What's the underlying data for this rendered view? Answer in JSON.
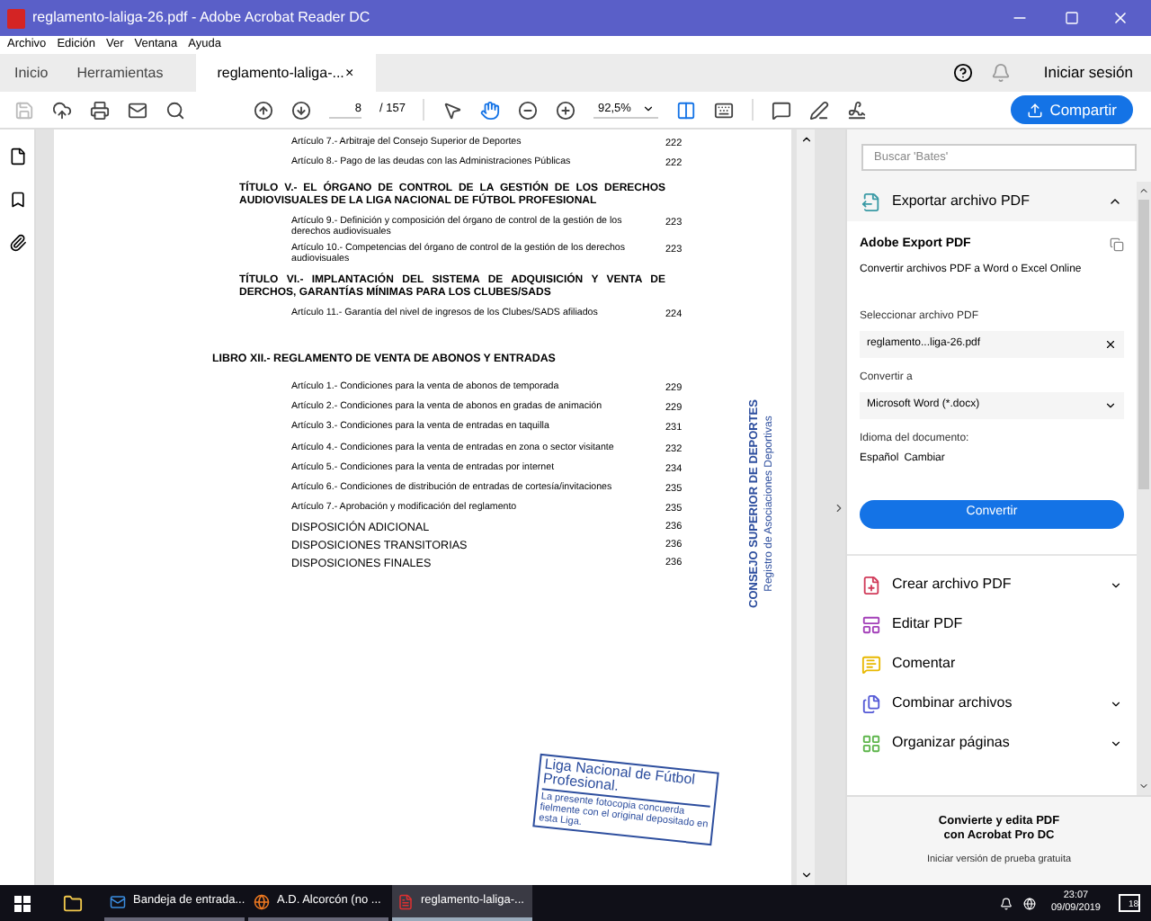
{
  "window": {
    "title": "reglamento-laliga-26.pdf - Adobe Acrobat Reader DC"
  },
  "menu": [
    "Archivo",
    "Edición",
    "Ver",
    "Ventana",
    "Ayuda"
  ],
  "tabs": [
    {
      "label": "Inicio",
      "selected": false,
      "kind": "nav"
    },
    {
      "label": "Herramientas",
      "selected": false,
      "kind": "nav"
    },
    {
      "label": "reglamento-laliga-...",
      "selected": true,
      "kind": "document",
      "close": "×"
    }
  ],
  "account": {
    "sign_in": "Iniciar sesión"
  },
  "toolbar": {
    "page": "8",
    "page_total": "/ 157",
    "zoom": "92,5%",
    "share": "Compartir"
  },
  "document": {
    "entries": [
      {
        "kind": "article",
        "text": "Artículo 7.- Arbitraje del Consejo Superior de Deportes",
        "page": "222"
      },
      {
        "kind": "article",
        "text": "Artículo 8.- Pago de las deudas con las Administraciones Públicas",
        "page": "222"
      },
      {
        "kind": "title",
        "text": "TÍTULO V.- EL ÓRGANO DE CONTROL DE LA GESTIÓN DE LOS DERECHOS AUDIOVISUALES DE LA LIGA NACIONAL DE FÚTBOL PROFESIONAL"
      },
      {
        "kind": "article",
        "text": "Artículo 9.- Definición y composición del órgano de control de la gestión de los derechos audiovisuales",
        "page": "223"
      },
      {
        "kind": "article",
        "text": "Artículo 10.- Competencias del órgano de control de la gestión de los derechos audiovisuales",
        "page": "223"
      },
      {
        "kind": "title",
        "text": "TÍTULO VI.- IMPLANTACIÓN DEL SISTEMA DE ADQUISICIÓN Y VENTA DE DERCHOS, GARANTÍAS MÍNIMAS PARA LOS CLUBES/SADS"
      },
      {
        "kind": "article",
        "text": "Artículo 11.- Garantía del nivel de ingresos de los Clubes/SADS afiliados",
        "page": "224"
      },
      {
        "kind": "part",
        "text": "LIBRO XII.- REGLAMENTO DE VENTA DE ABONOS Y ENTRADAS"
      },
      {
        "kind": "article",
        "text": "Artículo 1.- Condiciones para la venta de abonos de temporada",
        "page": "229"
      },
      {
        "kind": "article",
        "text": "Artículo 2.- Condiciones para la venta de abonos en gradas de animación",
        "page": "229"
      },
      {
        "kind": "article",
        "text": "Artículo 3.- Condiciones para la venta de entradas en taquilla",
        "page": "231"
      },
      {
        "kind": "article",
        "text": "Artículo 4.- Condiciones para la venta de entradas en zona o sector visitante",
        "page": "232"
      },
      {
        "kind": "article",
        "text": "Artículo 5.- Condiciones para la venta de entradas por internet",
        "page": "234"
      },
      {
        "kind": "article",
        "text": "Artículo 6.- Condiciones de distribución de entradas de cortesía/invitaciones",
        "page": "235"
      },
      {
        "kind": "article",
        "text": "Artículo 7.- Aprobación y modificación del reglamento",
        "page": "235"
      },
      {
        "kind": "disposition",
        "text": "DISPOSICIÓN ADICIONAL",
        "page": "236"
      },
      {
        "kind": "disposition",
        "text": "DISPOSICIONES TRANSITORIAS",
        "page": "236"
      },
      {
        "kind": "disposition",
        "text": "DISPOSICIONES FINALES",
        "page": "236"
      }
    ],
    "registry_stamp": {
      "line1": "CONSEJO SUPERIOR DE DEPORTES",
      "line2": "Registro de Asociaciones Deportivas"
    },
    "league_stamp": {
      "title": "Liga Nacional de Fútbol Profesional.",
      "note": "La presente fotocopia concuerda fielmente con el original depositado en esta Liga."
    }
  },
  "right_panel": {
    "search": {
      "placeholder": "Buscar 'Bates'"
    },
    "export": {
      "header": "Exportar archivo PDF",
      "expanded": true,
      "card_title": "Adobe Export PDF",
      "description": "Convertir archivos PDF a Word o Excel Online",
      "select_label": "Seleccionar archivo PDF",
      "file": "reglamento...liga-26.pdf",
      "convert_label": "Convertir a",
      "format": "Microsoft Word (*.docx)",
      "language_label": "Idioma del documento:",
      "language": "Español",
      "change_link": "Cambiar",
      "button": "Convertir"
    },
    "tools": [
      {
        "kind": "create",
        "label": "Crear archivo PDF",
        "expandable": true
      },
      {
        "kind": "edit",
        "label": "Editar PDF",
        "expandable": false
      },
      {
        "kind": "comment",
        "label": "Comentar",
        "expandable": false
      },
      {
        "kind": "combine",
        "label": "Combinar archivos",
        "expandable": true
      },
      {
        "kind": "organize",
        "label": "Organizar páginas",
        "expandable": true
      }
    ],
    "promo": {
      "line1": "Convierte y edita PDF",
      "line2": "con Acrobat Pro DC",
      "link": "Iniciar versión de prueba gratuita"
    }
  },
  "taskbar": {
    "apps": [
      {
        "kind": "mail",
        "label": "Bandeja de entrada...",
        "selected": false
      },
      {
        "kind": "browser",
        "label": "A.D. Alcorcón (no ...",
        "selected": false
      },
      {
        "kind": "pdf",
        "label": "reglamento-laliga-...",
        "selected": true
      }
    ],
    "time": "23:07",
    "date": "09/09/2019",
    "notifications": "18"
  }
}
